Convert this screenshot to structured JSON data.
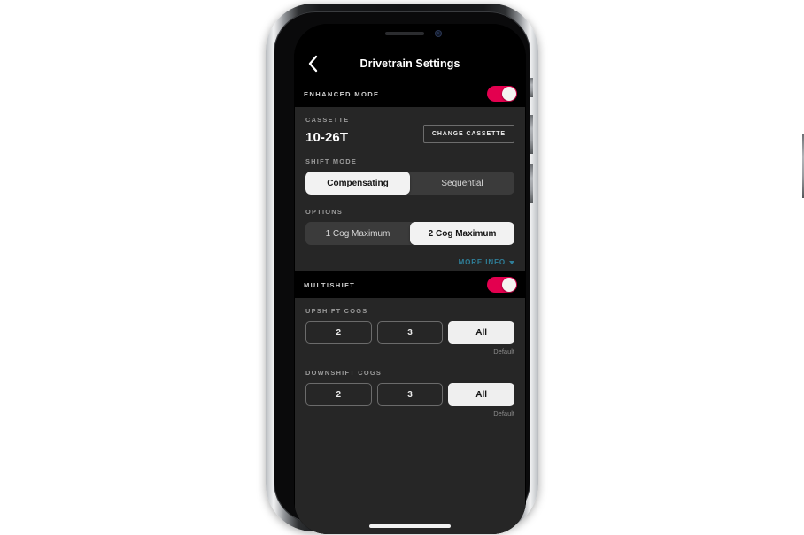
{
  "device": {
    "notch": {
      "speaker": "earpiece-speaker",
      "camera": "front-camera"
    },
    "home_indicator": "home-indicator"
  },
  "nav": {
    "back_icon": "chevron-left-icon",
    "title": "Drivetrain Settings"
  },
  "enhanced_mode": {
    "label": "ENHANCED MODE",
    "toggle_state": "on",
    "toggle_color": "#e3004f"
  },
  "cassette": {
    "label": "CASSETTE",
    "value": "10-26T",
    "change_button": "CHANGE CASSETTE"
  },
  "shift_mode": {
    "label": "SHIFT MODE",
    "options": [
      {
        "label": "Compensating",
        "selected": true
      },
      {
        "label": "Sequential",
        "selected": false
      }
    ]
  },
  "options": {
    "label": "OPTIONS",
    "options": [
      {
        "label": "1 Cog Maximum",
        "selected": false
      },
      {
        "label": "2 Cog Maximum",
        "selected": true
      }
    ]
  },
  "more_info": {
    "label": "MORE INFO",
    "caret_icon": "caret-down-icon",
    "color": "#2f7f99"
  },
  "multishift": {
    "label": "MULTISHIFT",
    "toggle_state": "on",
    "toggle_color": "#e3004f"
  },
  "upshift_cogs": {
    "label": "UPSHIFT COGS",
    "buttons": [
      {
        "label": "2",
        "selected": false
      },
      {
        "label": "3",
        "selected": false
      },
      {
        "label": "All",
        "selected": true
      }
    ],
    "default_note": "Default"
  },
  "downshift_cogs": {
    "label": "DOWNSHIFT COGS",
    "buttons": [
      {
        "label": "2",
        "selected": false
      },
      {
        "label": "3",
        "selected": false
      },
      {
        "label": "All",
        "selected": true
      }
    ],
    "default_note": "Default"
  }
}
